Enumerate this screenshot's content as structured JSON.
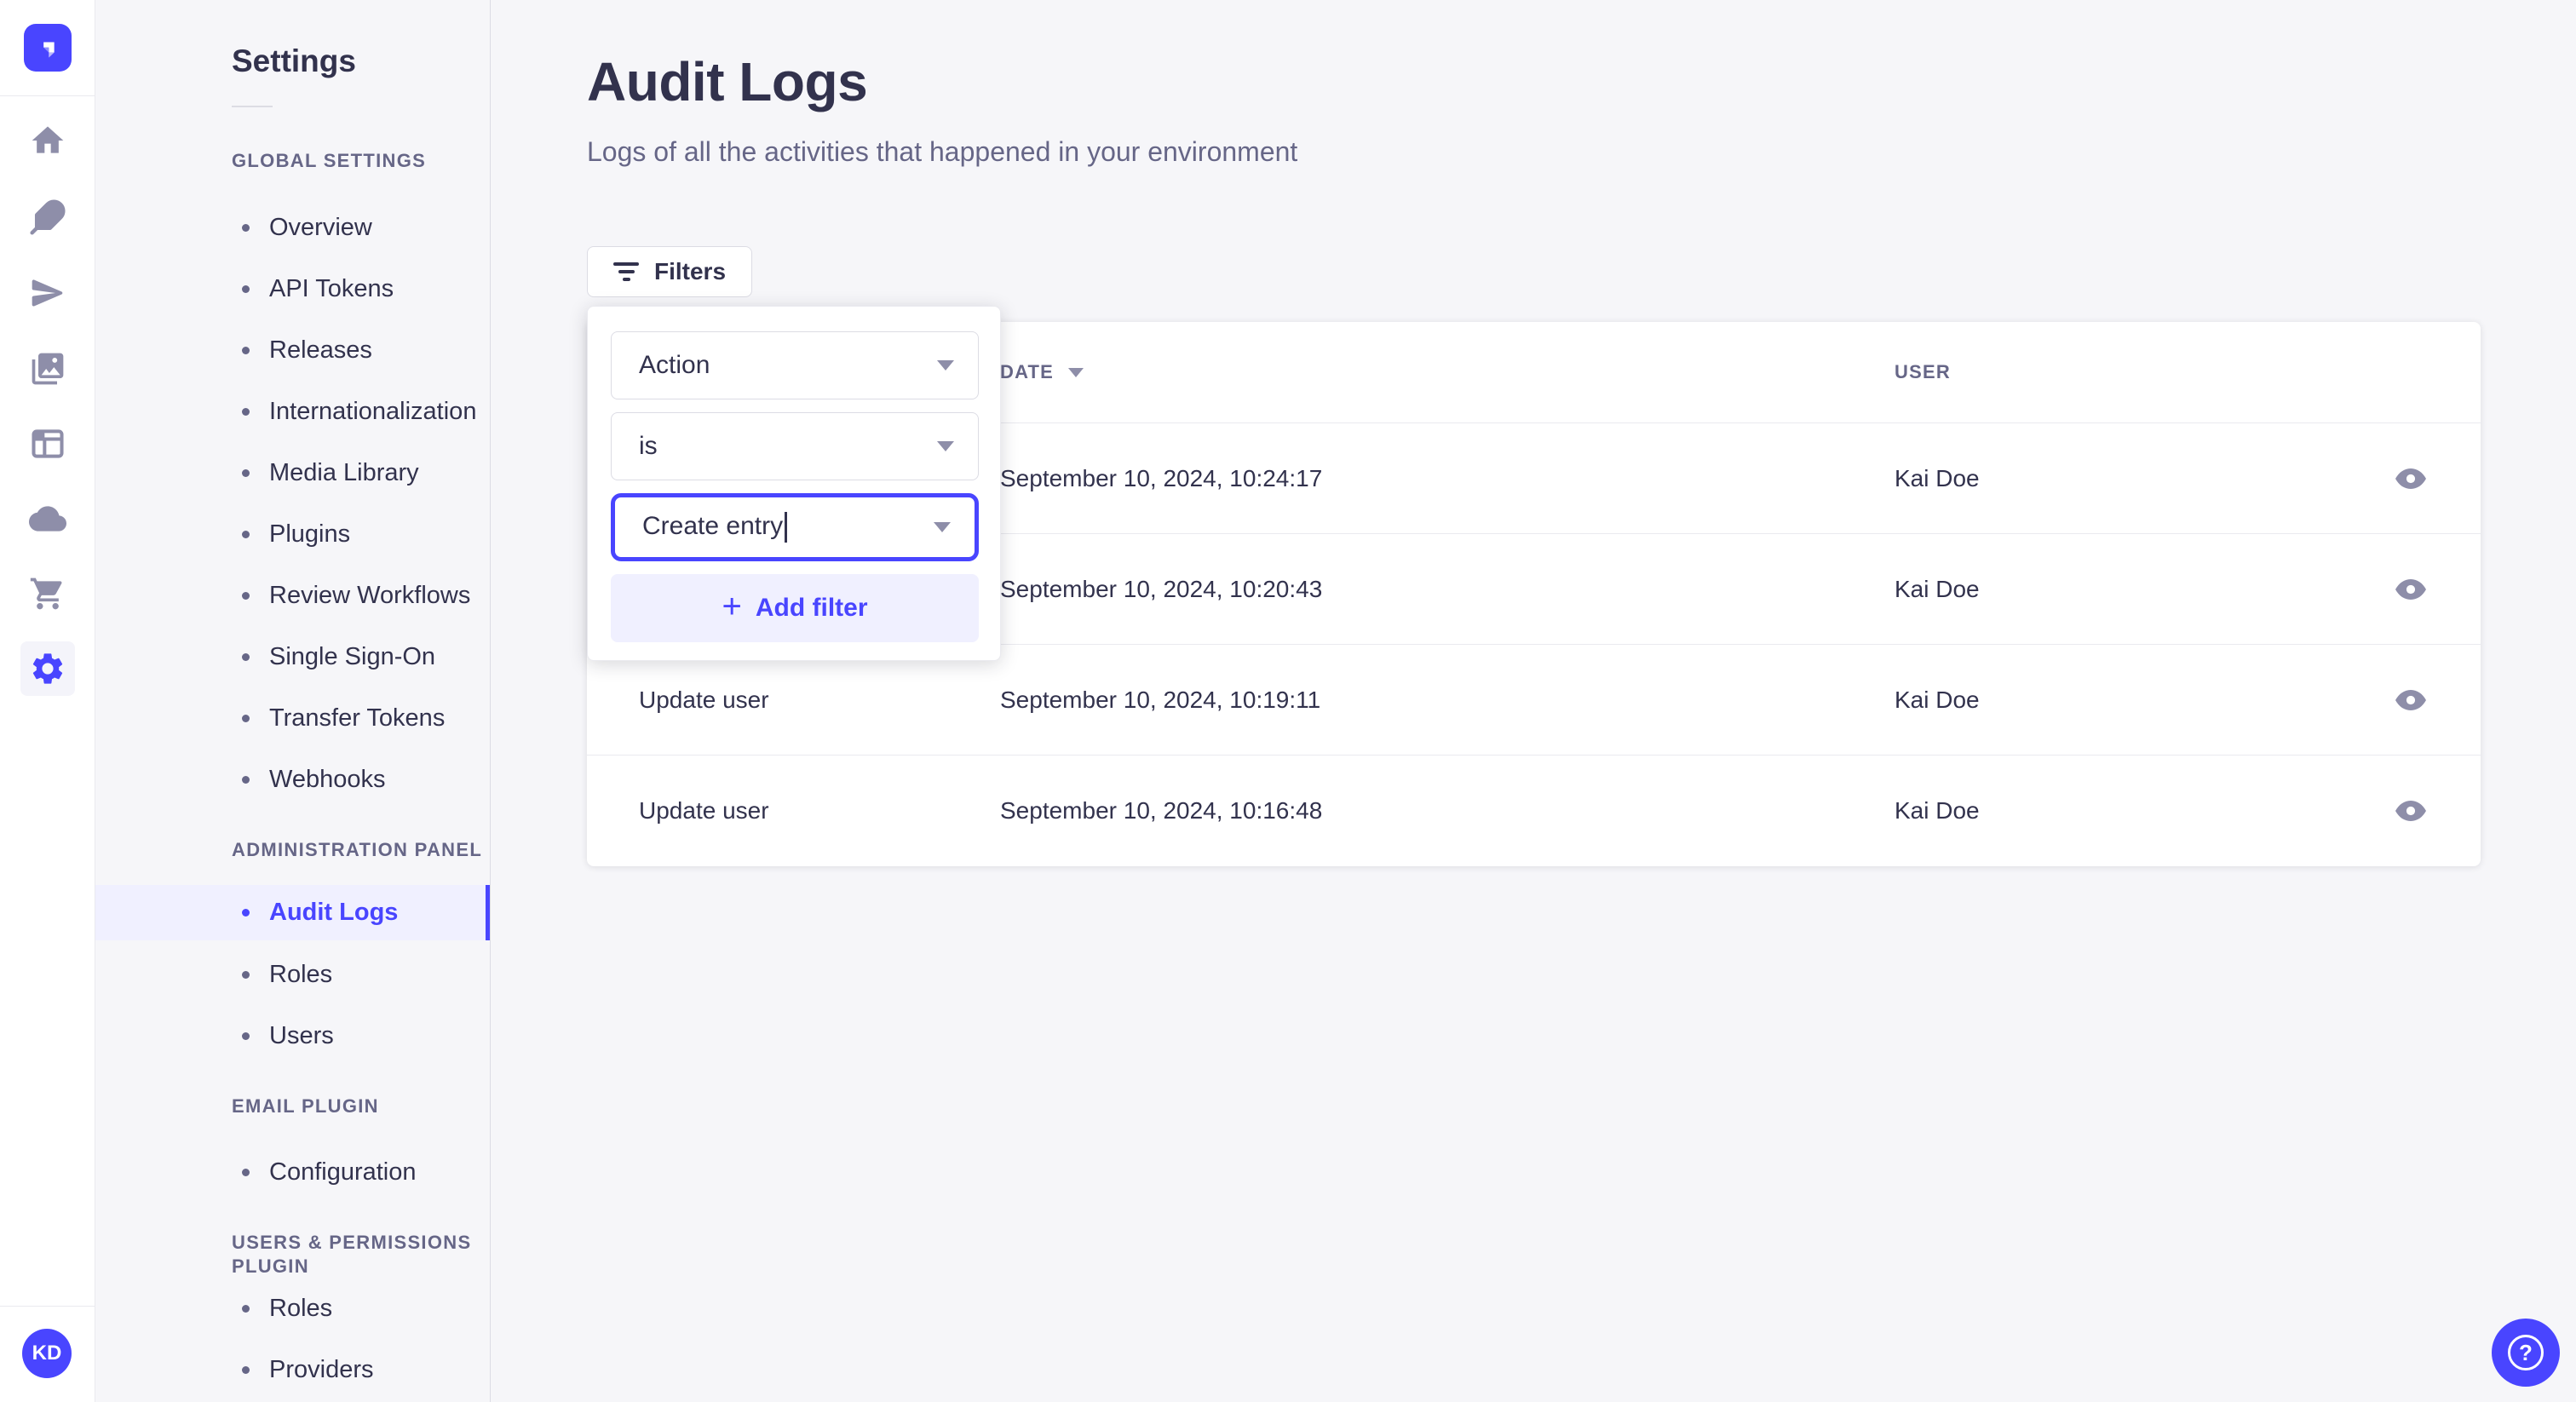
{
  "colors": {
    "primary": "#4945FF",
    "primary_light": "#F0F0FF",
    "app_background": "#F6F6F9",
    "text_dark": "#32324D",
    "text_muted": "#666687",
    "icon_muted": "#8E8EA9",
    "border": "#DCDCE4"
  },
  "rail": {
    "logo_icon": "strapi-logo",
    "icons": [
      "home-icon",
      "feather-icon",
      "paper-plane-icon",
      "media-library-icon",
      "layout-icon",
      "cloud-icon",
      "cart-icon",
      "settings-icon"
    ],
    "active_icon": "settings-icon",
    "avatar_initials": "KD"
  },
  "subnav": {
    "title": "Settings",
    "sections": [
      {
        "label": "GLOBAL SETTINGS",
        "items": [
          {
            "label": "Overview"
          },
          {
            "label": "API Tokens"
          },
          {
            "label": "Releases"
          },
          {
            "label": "Internationalization"
          },
          {
            "label": "Media Library"
          },
          {
            "label": "Plugins"
          },
          {
            "label": "Review Workflows"
          },
          {
            "label": "Single Sign-On"
          },
          {
            "label": "Transfer Tokens"
          },
          {
            "label": "Webhooks"
          }
        ]
      },
      {
        "label": "ADMINISTRATION PANEL",
        "items": [
          {
            "label": "Audit Logs",
            "active": true
          },
          {
            "label": "Roles"
          },
          {
            "label": "Users"
          }
        ]
      },
      {
        "label": "EMAIL PLUGIN",
        "items": [
          {
            "label": "Configuration"
          }
        ]
      },
      {
        "label": "USERS & PERMISSIONS PLUGIN",
        "items": [
          {
            "label": "Roles"
          },
          {
            "label": "Providers"
          }
        ]
      }
    ]
  },
  "header": {
    "title": "Audit Logs",
    "subtitle": "Logs of all the activities that happened in your environment"
  },
  "toolbar": {
    "filters_label": "Filters"
  },
  "filter_popover": {
    "field_value": "Action",
    "operator_value": "is",
    "value_value": "Create entry",
    "add_filter_label": "Add filter"
  },
  "table": {
    "columns": [
      {
        "label": ""
      },
      {
        "label": "DATE",
        "sorted": "desc"
      },
      {
        "label": "USER"
      }
    ],
    "rows": [
      {
        "action": "",
        "date": "September 10, 2024, 10:24:17",
        "user": "Kai Doe"
      },
      {
        "action": "",
        "date": "September 10, 2024, 10:20:43",
        "user": "Kai Doe"
      },
      {
        "action": "Update user",
        "date": "September 10, 2024, 10:19:11",
        "user": "Kai Doe"
      },
      {
        "action": "Update user",
        "date": "September 10, 2024, 10:16:48",
        "user": "Kai Doe"
      }
    ]
  },
  "help": {
    "icon": "question-mark-icon"
  }
}
